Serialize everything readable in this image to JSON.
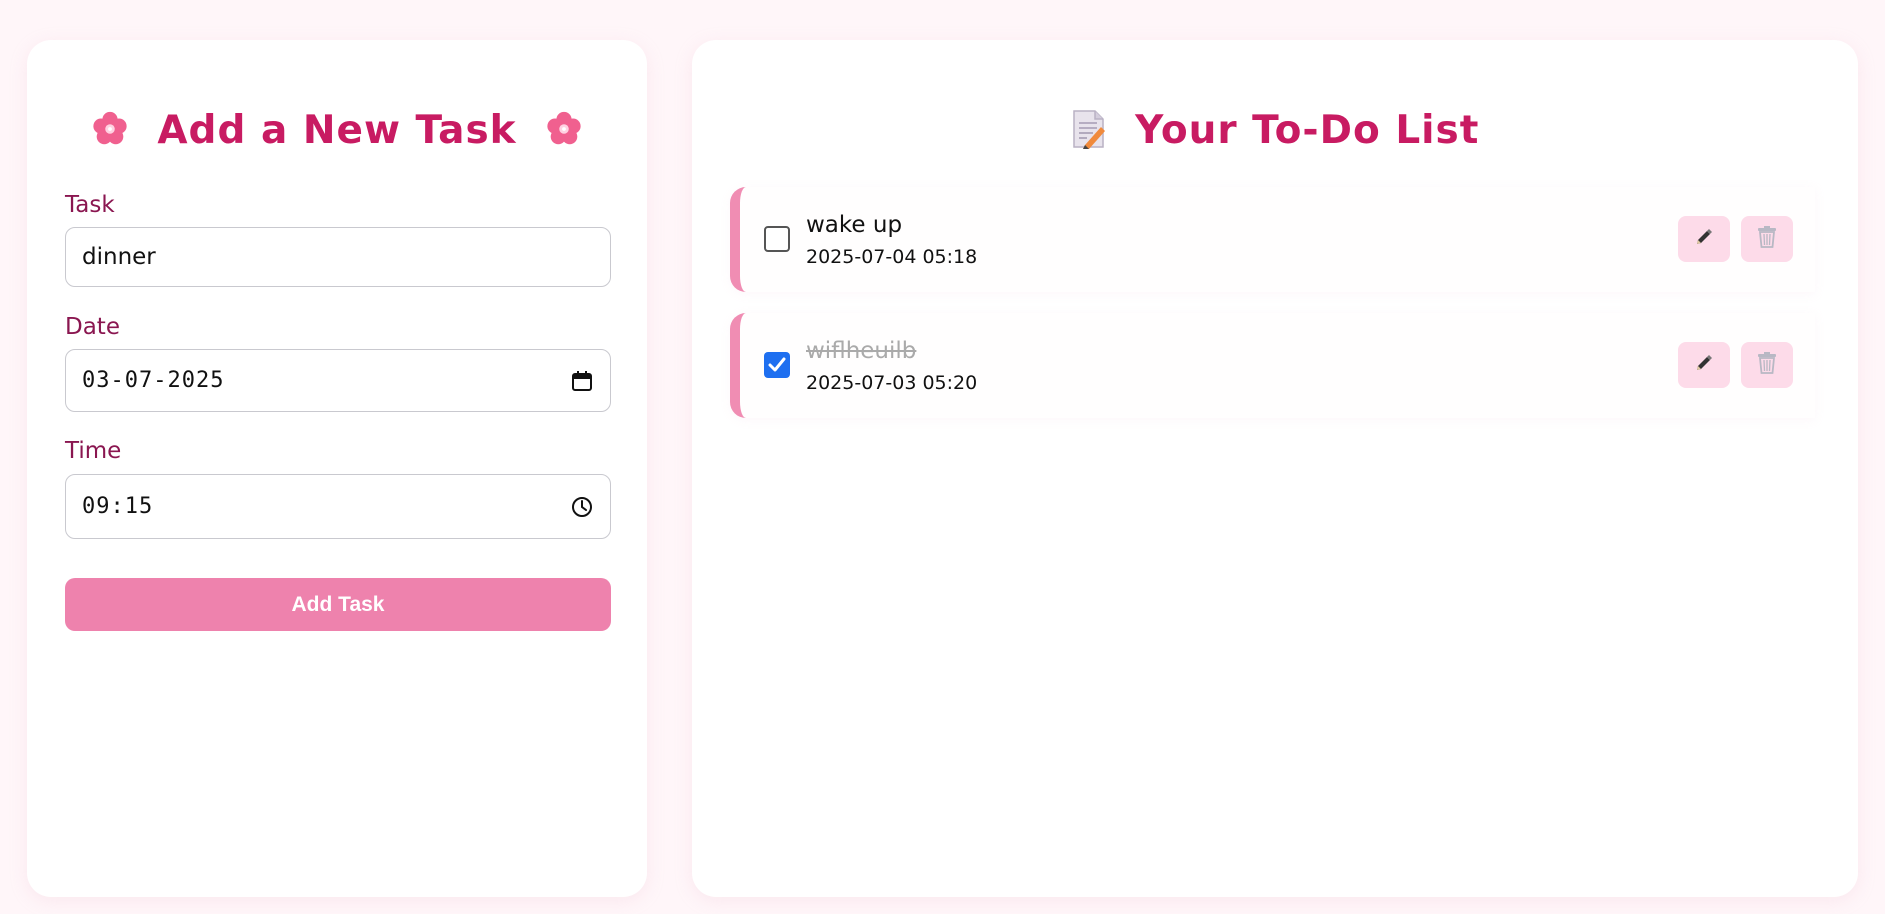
{
  "add_form": {
    "title": "Add a New Task",
    "title_icons": [
      "cherry-blossom-icon",
      "cherry-blossom-icon"
    ],
    "task_label": "Task",
    "task_value": "dinner",
    "date_label": "Date",
    "date_value": "03-07-2025",
    "time_label": "Time",
    "time_value": "09:15",
    "add_button_label": "Add Task"
  },
  "todo_list": {
    "title": "Your To-Do List",
    "title_icon": "memo-icon",
    "tasks": [
      {
        "name": "wake up",
        "datetime": "2025-07-04 05:18",
        "completed": false
      },
      {
        "name": "wiflheuilb",
        "datetime": "2025-07-03 05:20",
        "completed": true
      }
    ]
  },
  "colors": {
    "background": "#fff6f9",
    "title": "#c81b62",
    "label": "#8a1650",
    "accent": "#ee82ad",
    "item_border": "#f08db3",
    "icon_button_bg": "#fddbe9",
    "checkbox_checked": "#1e6ff0"
  }
}
